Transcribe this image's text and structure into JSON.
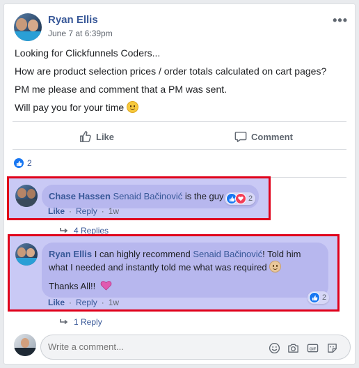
{
  "post": {
    "author": "Ryan Ellis",
    "time": "June 7 at 6:39pm",
    "menu": "•••",
    "lines": [
      "Looking for Clickfunnels Coders...",
      "How are product selection prices / order totals calculated on cart pages?",
      "PM me please and comment that a PM was sent.",
      "Will pay you for your time"
    ],
    "actions": {
      "like": "Like",
      "comment": "Comment"
    },
    "reaction_count": "2"
  },
  "comments": [
    {
      "author": "Chase Hassen",
      "mention": "Senaid Bačinović",
      "text": " is the guy",
      "reaction_count": "2",
      "like": "Like",
      "reply": "Reply",
      "age": "1w",
      "replies": "4 Replies"
    },
    {
      "author": "Ryan Ellis",
      "pre": " I can highly recommend ",
      "mention": "Senaid Bačinović",
      "text": "! Told him what I needed and instantly told me what was required",
      "thanks": "Thanks All!!",
      "reaction_count": "2",
      "like": "Like",
      "reply": "Reply",
      "age": "1w",
      "replies": "1 Reply"
    }
  ],
  "composer": {
    "placeholder": "Write a comment..."
  },
  "colors": {
    "highlight_border": "#e0001a",
    "highlight_fill": "#c9c9f5",
    "link": "#385898",
    "like_blue": "#1877f2",
    "heart": "#f33e58"
  },
  "icons": [
    "emoji-icon",
    "camera-icon",
    "gif-icon",
    "sticker-icon"
  ]
}
